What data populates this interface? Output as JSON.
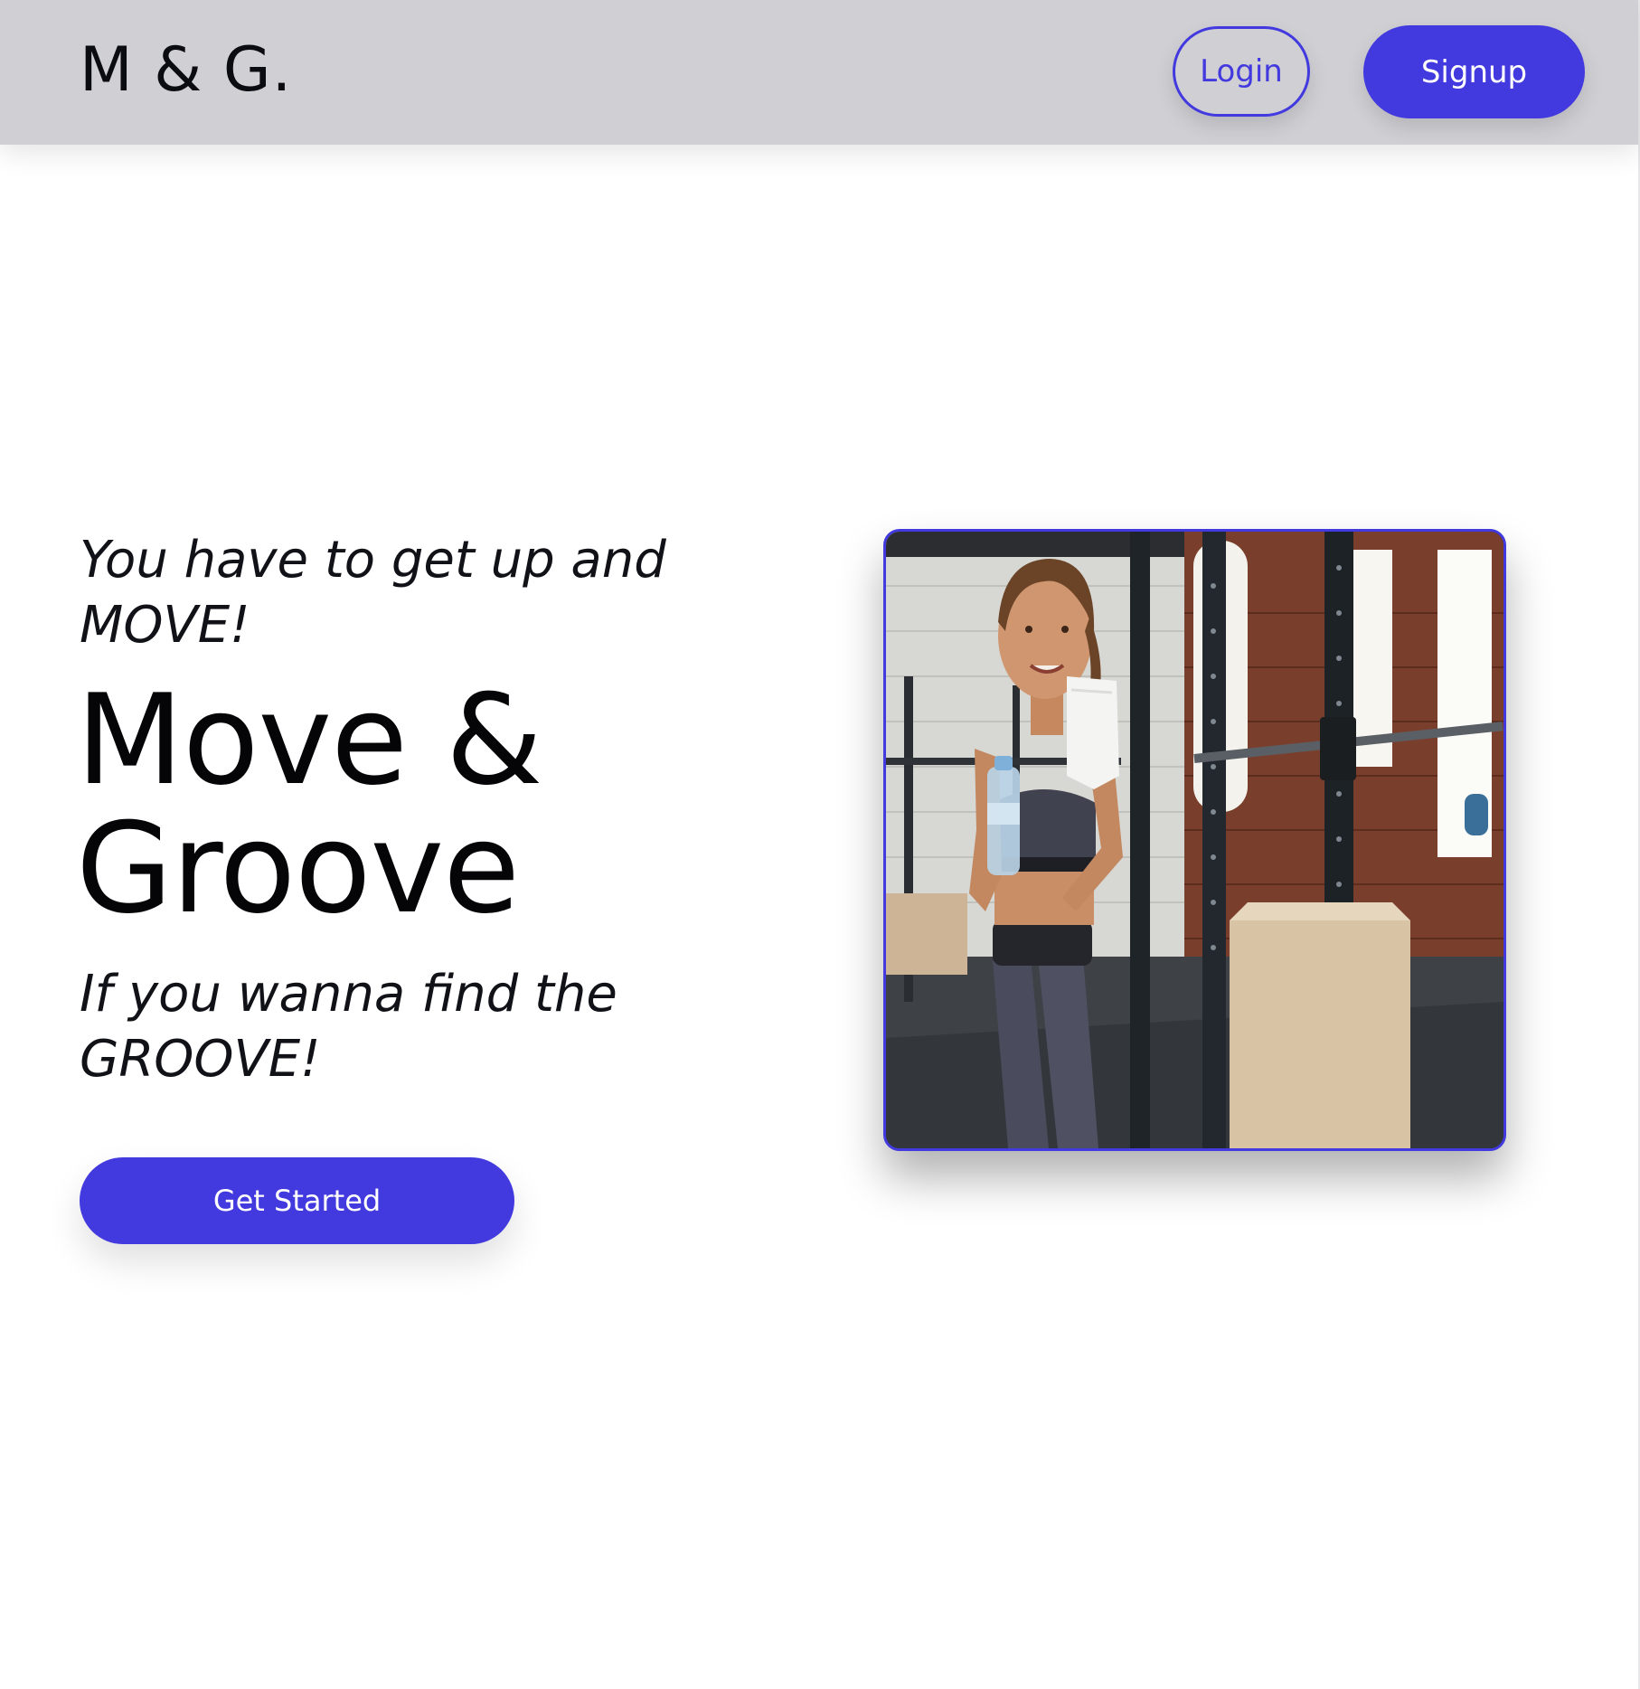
{
  "header": {
    "logo": "M & G.",
    "login_label": "Login",
    "signup_label": "Signup"
  },
  "hero": {
    "tagline_top": "You have to get up and MOVE!",
    "title_line1": "Move &",
    "title_line2": "Groove",
    "tagline_bottom": "If you wanna find the GROOVE!",
    "cta_label": "Get Started",
    "image_icon": "gym-woman-photo"
  },
  "colors": {
    "accent": "#4239de",
    "header_bg": "#cfcfd4",
    "text": "#050508"
  }
}
